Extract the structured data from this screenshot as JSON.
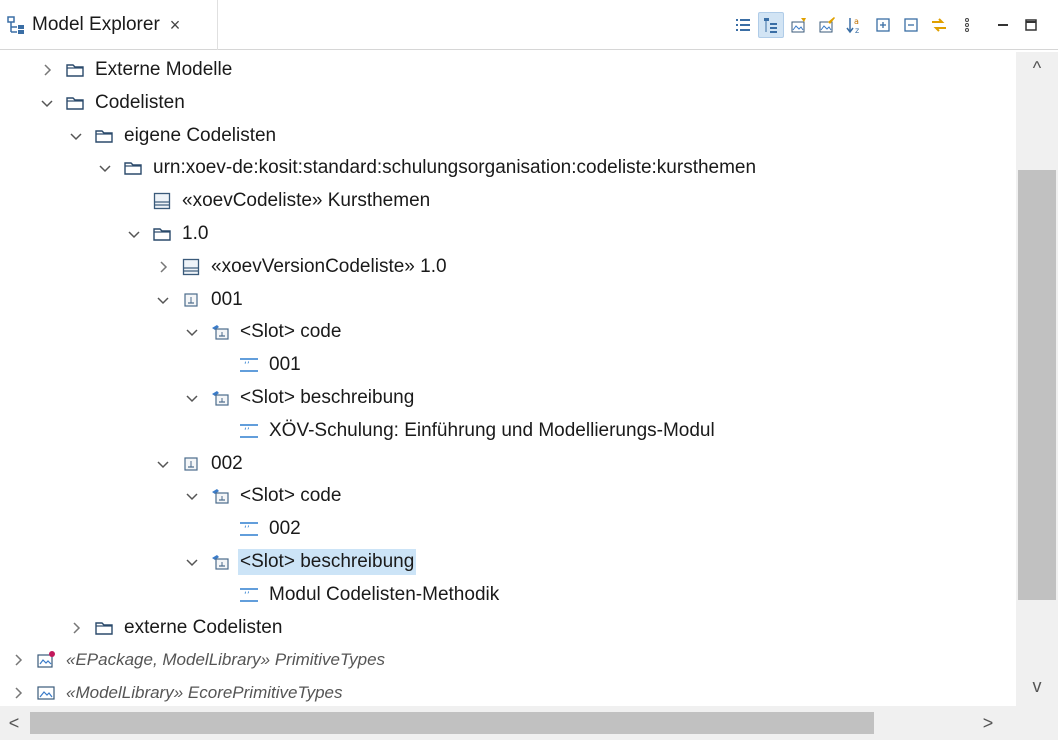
{
  "tab": {
    "title": "Model Explorer",
    "close": "×",
    "icon": "model-explorer-icon"
  },
  "toolbar": [
    {
      "name": "show-list-icon",
      "pressed": false
    },
    {
      "name": "show-tree-icon",
      "pressed": true
    },
    {
      "name": "filter-diagrams-icon",
      "pressed": false
    },
    {
      "name": "filter-edit-icon",
      "pressed": false
    },
    {
      "name": "sort-alphabetically-icon",
      "pressed": false
    },
    {
      "name": "expand-all-icon",
      "pressed": false
    },
    {
      "name": "collapse-all-icon",
      "pressed": false
    },
    {
      "name": "link-with-editor-icon",
      "pressed": false
    },
    {
      "name": "view-menu-icon",
      "pressed": false
    },
    {
      "name": "minimize-icon",
      "pressed": false
    },
    {
      "name": "maximize-icon",
      "pressed": false
    }
  ],
  "tree": [
    {
      "label": "Externe Modelle",
      "depth": 2,
      "expander": "collapsed",
      "icon": "folder-icon"
    },
    {
      "label": "Codelisten",
      "depth": 2,
      "expander": "expanded",
      "icon": "folder-icon"
    },
    {
      "label": "eigene Codelisten",
      "depth": 3,
      "expander": "expanded",
      "icon": "folder-icon"
    },
    {
      "label": "urn:xoev-de:kosit:standard:schulungsorganisation:codeliste:kursthemen",
      "depth": 4,
      "expander": "expanded",
      "icon": "folder-icon"
    },
    {
      "label": "«xoevCodeliste» Kursthemen",
      "depth": 5,
      "expander": "none",
      "icon": "class-icon"
    },
    {
      "label": "1.0",
      "depth": 5,
      "expander": "expanded",
      "icon": "folder-icon"
    },
    {
      "label": "«xoevVersionCodeliste» 1.0",
      "depth": 6,
      "expander": "collapsed",
      "icon": "class-icon"
    },
    {
      "label": "001",
      "depth": 6,
      "expander": "expanded",
      "icon": "instance-icon"
    },
    {
      "label": "<Slot> code",
      "depth": 7,
      "expander": "expanded",
      "icon": "slot-icon"
    },
    {
      "label": "001",
      "depth": 8,
      "expander": "none",
      "icon": "literal-string-icon"
    },
    {
      "label": "<Slot> beschreibung",
      "depth": 7,
      "expander": "expanded",
      "icon": "slot-icon"
    },
    {
      "label": "XÖV-Schulung: Einführung und Modellierungs-Modul",
      "depth": 8,
      "expander": "none",
      "icon": "literal-string-icon"
    },
    {
      "label": "002",
      "depth": 6,
      "expander": "expanded",
      "icon": "instance-icon"
    },
    {
      "label": "<Slot> code",
      "depth": 7,
      "expander": "expanded",
      "icon": "slot-icon"
    },
    {
      "label": "002",
      "depth": 8,
      "expander": "none",
      "icon": "literal-string-icon"
    },
    {
      "label": "<Slot> beschreibung",
      "depth": 7,
      "expander": "expanded",
      "icon": "slot-icon",
      "selected": true
    },
    {
      "label": "Modul Codelisten-Methodik",
      "depth": 8,
      "expander": "none",
      "icon": "literal-string-icon"
    },
    {
      "label": "externe Codelisten",
      "depth": 3,
      "expander": "collapsed",
      "icon": "folder-icon"
    },
    {
      "label": "«EPackage, ModelLibrary» PrimitiveTypes",
      "depth": 1,
      "expander": "collapsed",
      "icon": "epackage-icon",
      "italic": true
    },
    {
      "label": "«ModelLibrary» EcorePrimitiveTypes",
      "depth": 1,
      "expander": "collapsed",
      "icon": "model-library-icon",
      "italic": true
    }
  ],
  "scroll": {
    "up": "^",
    "down": "v",
    "left": "<",
    "right": ">"
  }
}
